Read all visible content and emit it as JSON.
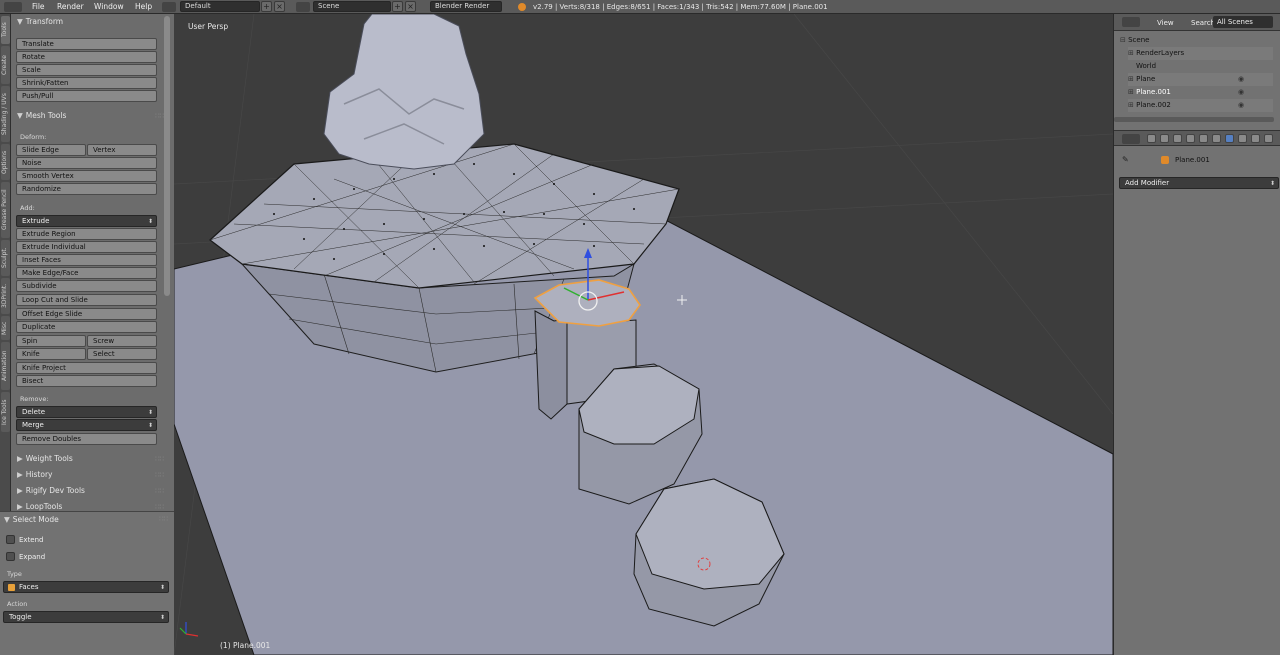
{
  "topbar": {
    "menus": [
      "File",
      "Render",
      "Window",
      "Help"
    ],
    "layout": "Default",
    "scene": "Scene",
    "engine": "Blender Render",
    "stats": "v2.79 | Verts:8/318 | Edges:8/651 | Faces:1/343 | Tris:542 | Mem:77.60M | Plane.001"
  },
  "tabs": [
    "Tools",
    "Create",
    "Shading / UVs",
    "Options",
    "Grease Pencil",
    "Sculpt.",
    "3DPrint.",
    "Misc",
    "Animation",
    "Ice Tools"
  ],
  "shelf": {
    "transform": {
      "title": "Transform",
      "buttons": [
        "Translate",
        "Rotate",
        "Scale",
        "Shrink/Fatten",
        "Push/Pull"
      ]
    },
    "mesh_tools": {
      "title": "Mesh Tools",
      "deform_label": "Deform:",
      "slide_edge": "Slide Edge",
      "vertex": "Vertex",
      "noise": "Noise",
      "smooth_vertex": "Smooth Vertex",
      "randomize": "Randomize",
      "add_label": "Add:",
      "extrude": "Extrude",
      "add_buttons": [
        "Extrude Region",
        "Extrude Individual",
        "Inset Faces",
        "Make Edge/Face",
        "Subdivide",
        "Loop Cut and Slide",
        "Offset Edge Slide",
        "Duplicate"
      ],
      "spin": "Spin",
      "screw": "Screw",
      "knife": "Knife",
      "select": "Select",
      "knife_project": "Knife Project",
      "bisect": "Bisect",
      "remove_label": "Remove:",
      "delete": "Delete",
      "merge": "Merge",
      "remove_doubles": "Remove Doubles"
    },
    "collapsed": [
      "Weight Tools",
      "History",
      "Rigify Dev Tools",
      "LoopTools"
    ]
  },
  "operator": {
    "title": "Select Mode",
    "extend": "Extend",
    "expand": "Expand",
    "type_label": "Type",
    "type_value": "Faces",
    "action_label": "Action",
    "action_value": "Toggle"
  },
  "viewport": {
    "view_name": "User Persp",
    "object_label": "(1) Plane.001"
  },
  "outliner": {
    "header": [
      "View",
      "Search",
      "All Scenes"
    ],
    "rows": [
      "Scene",
      "RenderLayers",
      "World",
      "Plane",
      "Plane.001",
      "Plane.002"
    ]
  },
  "properties": {
    "object_name": "Plane.001",
    "add_modifier": "Add Modifier"
  },
  "colors": {
    "viewport_bg": "#3d3d3d",
    "ground": "#9598ab",
    "mesh": "#a5a8b6",
    "selected": "#f0a040"
  }
}
